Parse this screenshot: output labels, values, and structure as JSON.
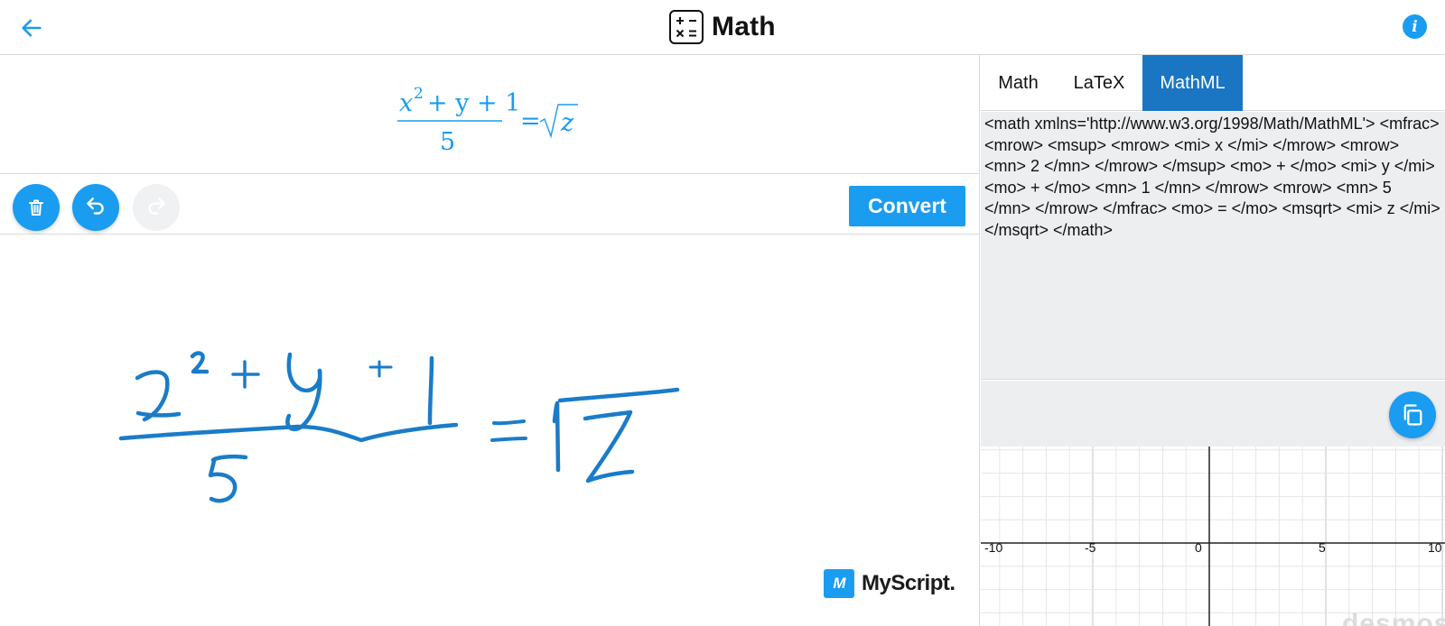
{
  "header": {
    "title": "Math",
    "back_icon": "arrow-left-icon",
    "info_icon": "info-icon",
    "info_glyph": "i"
  },
  "result": {
    "formula_text": "x^2 + y + 1 over 5 = sqrt z",
    "num_base": "x",
    "num_exp": "2",
    "num_rest": "+ y + 1",
    "denominator": "5",
    "equals": "=",
    "radicand": "z"
  },
  "toolbar": {
    "clear_icon": "trash-icon",
    "undo_icon": "undo-icon",
    "redo_icon": "redo-icon",
    "convert_label": "Convert"
  },
  "brand": {
    "logo_text": "M",
    "name": "MyScript."
  },
  "tabs": [
    {
      "label": "Math",
      "active": false
    },
    {
      "label": "LaTeX",
      "active": false
    },
    {
      "label": "MathML",
      "active": true
    }
  ],
  "output": {
    "text": "<math xmlns='http://www.w3.org/1998/Math/MathML'> <mfrac> <mrow> <msup> <mrow> <mi> x </mi> </mrow> <mrow> <mn> 2 </mn> </mrow> </msup> <mo> + </mo> <mi> y </mi> <mo> + </mo> <mn> 1 </mn> </mrow> <mrow> <mn> 5 </mn> </mrow> </mfrac> <mo> = </mo> <msqrt> <mi> z </mi> </msqrt> </math>",
    "copy_icon": "copy-icon"
  },
  "graph": {
    "x_ticks": [
      "-10",
      "-5",
      "0",
      "5",
      "10"
    ],
    "watermark": "desmos"
  },
  "colors": {
    "accent": "#1a9cf0",
    "active_tab": "#1a75c2",
    "ink": "#1a7cc8",
    "panel_bg": "#eceef0"
  }
}
